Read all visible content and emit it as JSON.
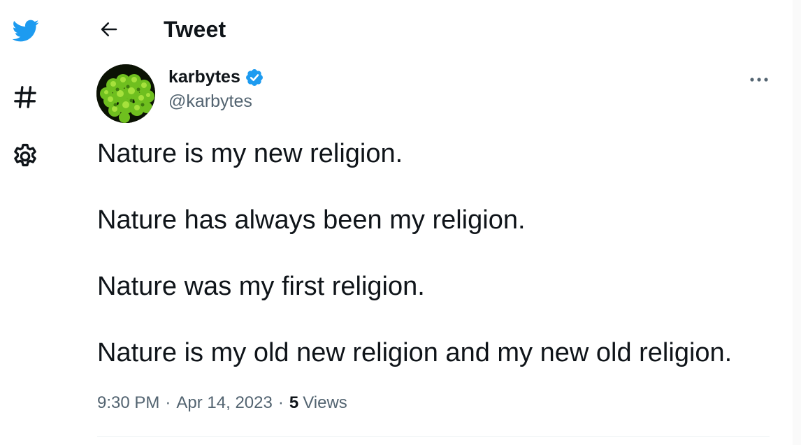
{
  "header": {
    "title": "Tweet"
  },
  "nav": {
    "items": [
      {
        "name": "twitter-logo-icon",
        "color": "#1d9bf0"
      },
      {
        "name": "hashtag-icon"
      },
      {
        "name": "settings-gear-icon"
      }
    ]
  },
  "tweet": {
    "author": {
      "display_name": "karbytes",
      "handle": "@karbytes",
      "verified": true,
      "badge_color": "#1d9bf0"
    },
    "lines": [
      "Nature is my new religion.",
      "Nature has always been my religion.",
      "Nature was my first religion.",
      "Nature is my old new religion and my new old religion."
    ],
    "time": "9:30 PM",
    "separator": "·",
    "date": "Apr 14, 2023",
    "views_count": "5",
    "views_label": "Views"
  },
  "colors": {
    "text_primary": "#0f1419",
    "text_secondary": "#536471",
    "accent": "#1d9bf0",
    "divider": "#eff3f4"
  }
}
